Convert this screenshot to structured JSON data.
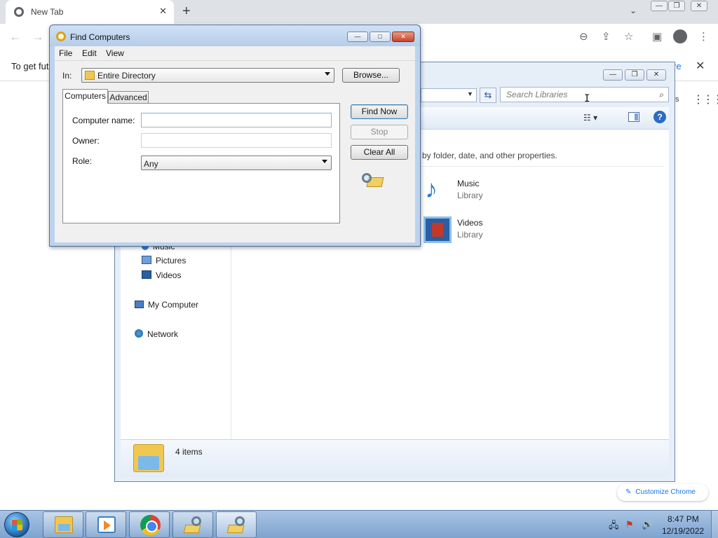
{
  "chrome": {
    "tab_title": "New Tab",
    "tab_close": "✕",
    "new_tab": "+",
    "tab_search": "⌄",
    "window_controls": {
      "minimize": "—",
      "restore": "❐",
      "close": "✕"
    },
    "nav": {
      "back": "←",
      "forward": "→"
    },
    "toolbar_icons": {
      "zoom": "⊖",
      "share": "⇪",
      "bookmark": "☆",
      "side_panel": "▣",
      "menu": "⋮"
    },
    "infobar": {
      "text": "To get fut",
      "link": "re",
      "close": "✕"
    },
    "apps_s": "s",
    "apps_grid": "⋮⋮⋮",
    "customize_button": {
      "icon": "✎",
      "label": "Customize Chrome"
    }
  },
  "explorer": {
    "caption": {
      "minimize": "—",
      "maximize": "❐",
      "close": "✕"
    },
    "address_dropdown": "▼",
    "refresh": "⇆",
    "search_placeholder": "Search Libraries",
    "search_icon": "⌕",
    "views_button": "☷ ▾",
    "help": "?",
    "library_description": "n by folder, date, and other properties.",
    "libraries": [
      {
        "name": "Music",
        "type": "Library",
        "icon": "music-library-icon"
      },
      {
        "name": "Videos",
        "type": "Library",
        "icon": "videos-library-icon"
      }
    ],
    "nav_items": [
      {
        "label": "Music"
      },
      {
        "label": "Pictures"
      },
      {
        "label": "Videos"
      },
      {
        "label": "My Computer"
      },
      {
        "label": "Network"
      }
    ],
    "details": {
      "count": "4 items"
    },
    "music_glyph": "♪"
  },
  "find_computers": {
    "title": "Find Computers",
    "caption": {
      "minimize": "—",
      "maximize": "□",
      "close": "✕"
    },
    "menu": [
      "File",
      "Edit",
      "View"
    ],
    "in_label": "In:",
    "in_value": "Entire Directory",
    "browse": "Browse...",
    "tabs": [
      "Computers",
      "Advanced"
    ],
    "fields": {
      "computer_name_label": "Computer name:",
      "computer_name_value": "",
      "owner_label": "Owner:",
      "owner_value": "",
      "role_label": "Role:",
      "role_value": "Any"
    },
    "buttons": {
      "find_now": "Find Now",
      "stop": "Stop",
      "clear_all": "Clear All"
    }
  },
  "taskbar": {
    "clock_time": "8:47 PM",
    "clock_date": "12/19/2022",
    "tray_icons": {
      "network": "🖧",
      "action_center": "⚑",
      "volume": "🔊"
    }
  },
  "cursor": "I"
}
